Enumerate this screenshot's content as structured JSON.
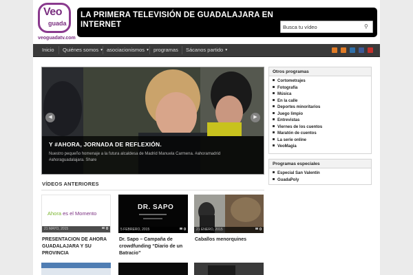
{
  "header": {
    "logo_text": "Veo guada",
    "logo_url": "veoguadatv.com",
    "title": "LA PRIMERA TELEVISIÓN DE GUADALAJARA EN INTERNET"
  },
  "search": {
    "placeholder": "Busca tu vídeo"
  },
  "nav": [
    {
      "label": "Inicio",
      "dropdown": false
    },
    {
      "label": "Quiénes somos",
      "dropdown": true
    },
    {
      "label": "asociacionismos",
      "dropdown": true
    },
    {
      "label": "programas",
      "dropdown": false
    },
    {
      "label": "Sácanos partido",
      "dropdown": true
    }
  ],
  "social_icons": [
    "rss-icon",
    "rss-icon",
    "google-plus-icon",
    "facebook-icon",
    "youtube-icon"
  ],
  "featured": {
    "title": "Y #AHORA, JORNADA DE REFLEXIÓN.",
    "description": "Nuestro pequeño homenaje a la futura alcaldesa de Madrid Manuela Carmena. #ahoramadrid #ahoraguadalajara. Share"
  },
  "videos_section_title": "VÍDEOS ANTERIORES",
  "videos": [
    {
      "date": "21 MAYO, 2015",
      "comments": "0",
      "title": "PRESENTACION DE AHORA GUADALAJARA Y SU PROVINCIA",
      "thumb_text": "Ahora es el Momento"
    },
    {
      "date": "5 FEBRERO, 2015",
      "comments": "0",
      "title": "Dr. Sapo – Campaña de crowdfunding “Diario de un Batracio”",
      "thumb_text": "DR. SAPO"
    },
    {
      "date": "21 ENERO, 2015",
      "comments": "0",
      "title": "Caballos menorquines",
      "thumb_text": ""
    }
  ],
  "sidebar": {
    "otros": {
      "title": "Otros programas",
      "items": [
        "Cortometrajes",
        "Fotografía",
        "Música",
        "En la calle",
        "Deportes minoritarios",
        "Juego limpio",
        "Entrevistas",
        "Viernes de los cuentos",
        "Maratón de cuentos",
        "La serie online",
        "VeoMagia"
      ]
    },
    "especiales": {
      "title": "Programas especiales",
      "items": [
        "Especial San Valentín",
        "GuadaPoly"
      ]
    }
  },
  "colors": {
    "brand": "#7a2f80",
    "nav_bg": "#3a3a3a",
    "banner_bg": "#000000"
  }
}
